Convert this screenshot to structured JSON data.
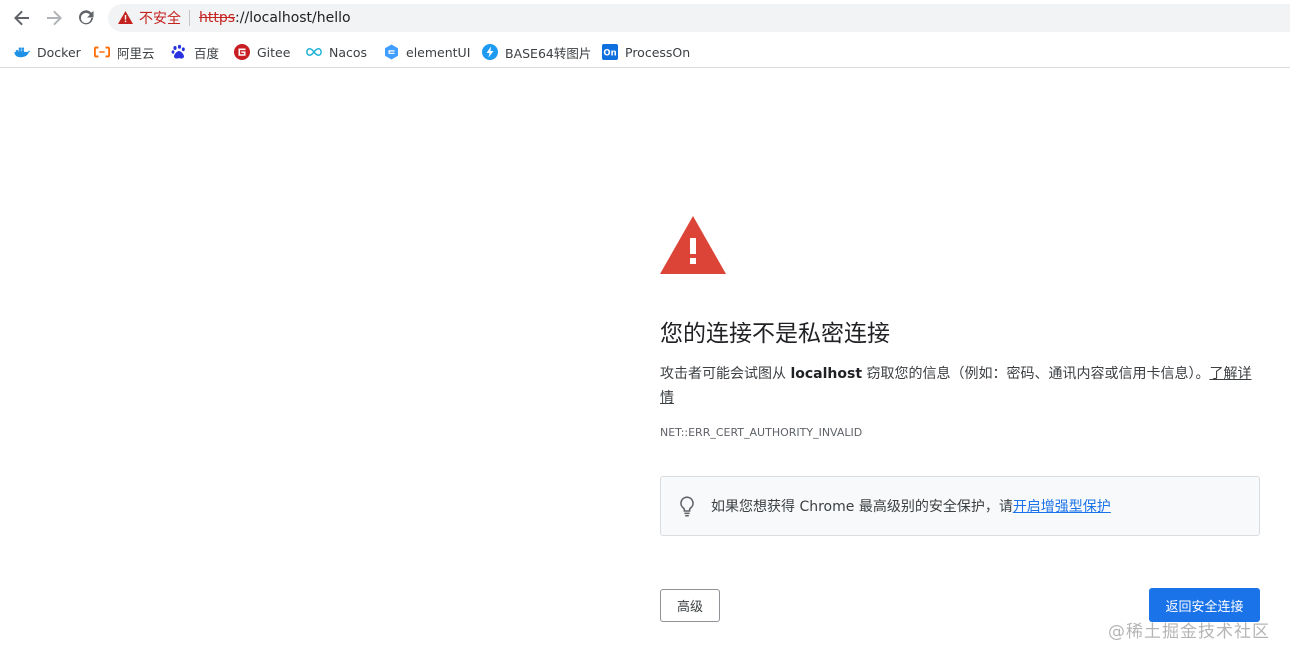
{
  "browser": {
    "security_label": "不安全",
    "url_scheme": "https",
    "url_rest": "://localhost/hello"
  },
  "bookmarks": [
    {
      "label": "Docker",
      "icon": "docker-icon"
    },
    {
      "label": "阿里云",
      "icon": "aliyun-icon"
    },
    {
      "label": "百度",
      "icon": "baidu-icon"
    },
    {
      "label": "Gitee",
      "icon": "gitee-icon"
    },
    {
      "label": "Nacos",
      "icon": "nacos-icon"
    },
    {
      "label": "elementUI",
      "icon": "element-icon"
    },
    {
      "label": "BASE64转图片",
      "icon": "base64-icon"
    },
    {
      "label": "ProcessOn",
      "icon": "processon-icon"
    }
  ],
  "interstitial": {
    "title": "您的连接不是私密连接",
    "message_before": "攻击者可能会试图从 ",
    "message_host": "localhost",
    "message_after": " 窃取您的信息（例如：密码、通讯内容或信用卡信息）。",
    "learn_more": "了解详情",
    "error_code": "NET::ERR_CERT_AUTHORITY_INVALID",
    "enhanced_text": "如果您想获得 Chrome 最高级别的安全保护，请",
    "enhanced_link": "开启增强型保护",
    "advanced_button": "高级",
    "back_button": "返回安全连接"
  },
  "watermark": "@稀土掘金技术社区",
  "colors": {
    "danger": "#c5221f",
    "warning_red": "#db4437",
    "primary_blue": "#1a73e8"
  }
}
